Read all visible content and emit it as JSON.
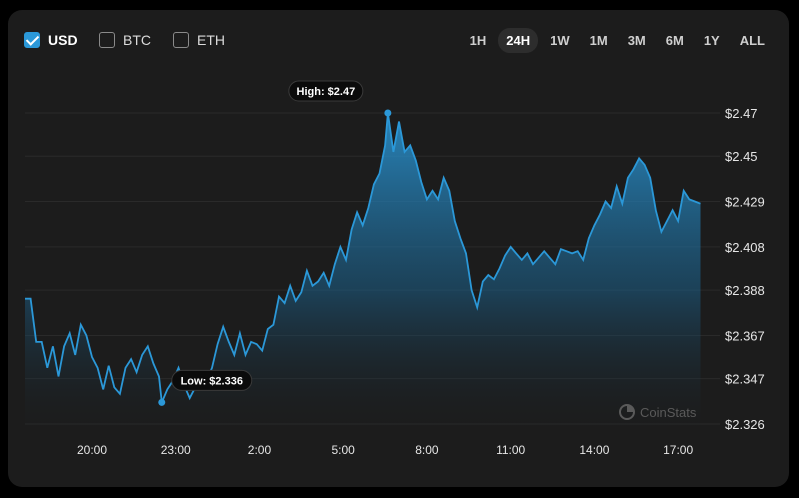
{
  "currencies": [
    {
      "label": "USD",
      "checked": true
    },
    {
      "label": "BTC",
      "checked": false
    },
    {
      "label": "ETH",
      "checked": false
    }
  ],
  "ranges": [
    "1H",
    "24H",
    "1W",
    "1M",
    "3M",
    "6M",
    "1Y",
    "ALL"
  ],
  "active_range": "24H",
  "watermark": "CoinStats",
  "high_label": "High: $2.47",
  "low_label": "Low: $2.336",
  "colors": {
    "line": "#2b98d8",
    "background": "#1c1c1c",
    "grid": "#2a2a2a"
  },
  "chart_data": {
    "type": "area",
    "x_unit": "hours",
    "x_ticks": [
      {
        "label": "20:00",
        "h": 20
      },
      {
        "label": "23:00",
        "h": 23
      },
      {
        "label": "2:00",
        "h": 26
      },
      {
        "label": "5:00",
        "h": 29
      },
      {
        "label": "8:00",
        "h": 32
      },
      {
        "label": "11:00",
        "h": 35
      },
      {
        "label": "14:00",
        "h": 38
      },
      {
        "label": "17:00",
        "h": 41
      }
    ],
    "y_ticks": [
      "$2.47",
      "$2.45",
      "$2.429",
      "$2.408",
      "$2.388",
      "$2.367",
      "$2.347",
      "$2.326"
    ],
    "y_tick_values": [
      2.47,
      2.45,
      2.429,
      2.408,
      2.388,
      2.367,
      2.347,
      2.326
    ],
    "ylim": [
      2.326,
      2.47
    ],
    "xlim": [
      17.6,
      42.5
    ],
    "high": {
      "x": 30.6,
      "y": 2.47
    },
    "low": {
      "x": 22.5,
      "y": 2.336
    },
    "points": [
      [
        17.6,
        2.384
      ],
      [
        17.8,
        2.384
      ],
      [
        18.0,
        2.364
      ],
      [
        18.2,
        2.364
      ],
      [
        18.4,
        2.352
      ],
      [
        18.6,
        2.362
      ],
      [
        18.8,
        2.348
      ],
      [
        19.0,
        2.362
      ],
      [
        19.2,
        2.368
      ],
      [
        19.4,
        2.358
      ],
      [
        19.6,
        2.372
      ],
      [
        19.8,
        2.367
      ],
      [
        20.0,
        2.357
      ],
      [
        20.2,
        2.352
      ],
      [
        20.4,
        2.342
      ],
      [
        20.6,
        2.353
      ],
      [
        20.8,
        2.343
      ],
      [
        21.0,
        2.34
      ],
      [
        21.2,
        2.352
      ],
      [
        21.4,
        2.356
      ],
      [
        21.6,
        2.35
      ],
      [
        21.8,
        2.358
      ],
      [
        22.0,
        2.362
      ],
      [
        22.2,
        2.354
      ],
      [
        22.4,
        2.348
      ],
      [
        22.5,
        2.336
      ],
      [
        22.7,
        2.342
      ],
      [
        22.9,
        2.346
      ],
      [
        23.1,
        2.352
      ],
      [
        23.3,
        2.344
      ],
      [
        23.5,
        2.338
      ],
      [
        23.7,
        2.343
      ],
      [
        23.9,
        2.345
      ],
      [
        24.1,
        2.346
      ],
      [
        24.3,
        2.352
      ],
      [
        24.5,
        2.363
      ],
      [
        24.7,
        2.371
      ],
      [
        24.9,
        2.364
      ],
      [
        25.1,
        2.358
      ],
      [
        25.3,
        2.368
      ],
      [
        25.5,
        2.358
      ],
      [
        25.7,
        2.364
      ],
      [
        25.9,
        2.363
      ],
      [
        26.1,
        2.36
      ],
      [
        26.3,
        2.37
      ],
      [
        26.5,
        2.372
      ],
      [
        26.7,
        2.385
      ],
      [
        26.9,
        2.382
      ],
      [
        27.1,
        2.39
      ],
      [
        27.3,
        2.383
      ],
      [
        27.5,
        2.387
      ],
      [
        27.7,
        2.397
      ],
      [
        27.9,
        2.39
      ],
      [
        28.1,
        2.392
      ],
      [
        28.3,
        2.396
      ],
      [
        28.5,
        2.39
      ],
      [
        28.7,
        2.4
      ],
      [
        28.9,
        2.408
      ],
      [
        29.1,
        2.402
      ],
      [
        29.3,
        2.416
      ],
      [
        29.5,
        2.424
      ],
      [
        29.7,
        2.418
      ],
      [
        29.9,
        2.426
      ],
      [
        30.1,
        2.437
      ],
      [
        30.3,
        2.442
      ],
      [
        30.5,
        2.455
      ],
      [
        30.6,
        2.47
      ],
      [
        30.8,
        2.452
      ],
      [
        31.0,
        2.466
      ],
      [
        31.2,
        2.452
      ],
      [
        31.4,
        2.455
      ],
      [
        31.6,
        2.448
      ],
      [
        31.8,
        2.438
      ],
      [
        32.0,
        2.43
      ],
      [
        32.2,
        2.434
      ],
      [
        32.4,
        2.43
      ],
      [
        32.6,
        2.44
      ],
      [
        32.8,
        2.434
      ],
      [
        33.0,
        2.42
      ],
      [
        33.2,
        2.412
      ],
      [
        33.4,
        2.405
      ],
      [
        33.6,
        2.388
      ],
      [
        33.8,
        2.38
      ],
      [
        34.0,
        2.392
      ],
      [
        34.2,
        2.395
      ],
      [
        34.4,
        2.393
      ],
      [
        34.6,
        2.398
      ],
      [
        34.8,
        2.404
      ],
      [
        35.0,
        2.408
      ],
      [
        35.2,
        2.405
      ],
      [
        35.4,
        2.402
      ],
      [
        35.6,
        2.405
      ],
      [
        35.8,
        2.4
      ],
      [
        36.0,
        2.403
      ],
      [
        36.2,
        2.406
      ],
      [
        36.4,
        2.403
      ],
      [
        36.6,
        2.4
      ],
      [
        36.8,
        2.407
      ],
      [
        37.0,
        2.406
      ],
      [
        37.2,
        2.405
      ],
      [
        37.4,
        2.406
      ],
      [
        37.6,
        2.402
      ],
      [
        37.8,
        2.412
      ],
      [
        38.0,
        2.418
      ],
      [
        38.2,
        2.423
      ],
      [
        38.4,
        2.429
      ],
      [
        38.6,
        2.426
      ],
      [
        38.8,
        2.436
      ],
      [
        39.0,
        2.428
      ],
      [
        39.2,
        2.44
      ],
      [
        39.4,
        2.444
      ],
      [
        39.6,
        2.449
      ],
      [
        39.8,
        2.446
      ],
      [
        40.0,
        2.44
      ],
      [
        40.2,
        2.425
      ],
      [
        40.4,
        2.415
      ],
      [
        40.6,
        2.42
      ],
      [
        40.8,
        2.425
      ],
      [
        41.0,
        2.42
      ],
      [
        41.2,
        2.434
      ],
      [
        41.4,
        2.43
      ],
      [
        41.6,
        2.429
      ],
      [
        41.8,
        2.428
      ]
    ]
  }
}
